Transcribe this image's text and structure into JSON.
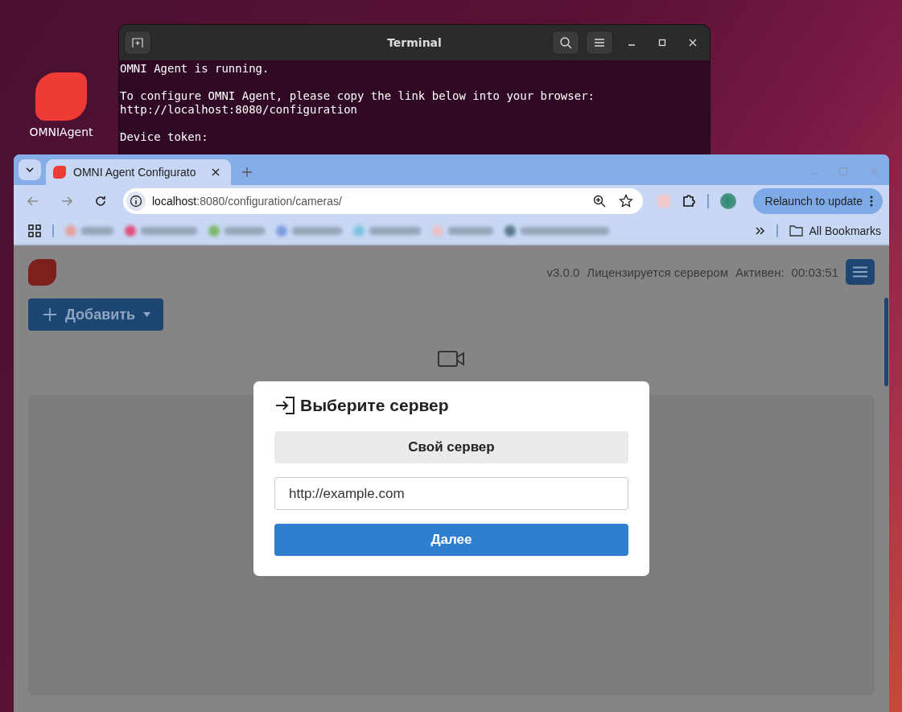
{
  "desktop": {
    "icons": [
      {
        "label": "OMNIAgent"
      }
    ]
  },
  "terminal": {
    "title": "Terminal",
    "paragraphs": [
      [
        "OMNI Agent is running."
      ],
      [
        "To configure OMNI Agent, please copy the link below into your browser:",
        "http://localhost:8080/configuration"
      ],
      [
        "Device token:"
      ]
    ]
  },
  "browser": {
    "tab": {
      "title": "OMNI Agent Configurato",
      "selected": true
    },
    "address": {
      "host": "localhost",
      "path": ":8080/configuration/cameras/"
    },
    "update_button": "Relaunch to update",
    "bookmarks_folder": "All Bookmarks"
  },
  "page": {
    "version": "v3.0.0",
    "license": "Лицензируется сервером",
    "active_label": "Активен:",
    "active_time": "00:03:51",
    "add_button": "Добавить"
  },
  "dialog": {
    "title": "Выберите сервер",
    "server_option": "Свой сервер",
    "url_field": {
      "value": "http://example.com"
    },
    "next_button": "Далее"
  }
}
